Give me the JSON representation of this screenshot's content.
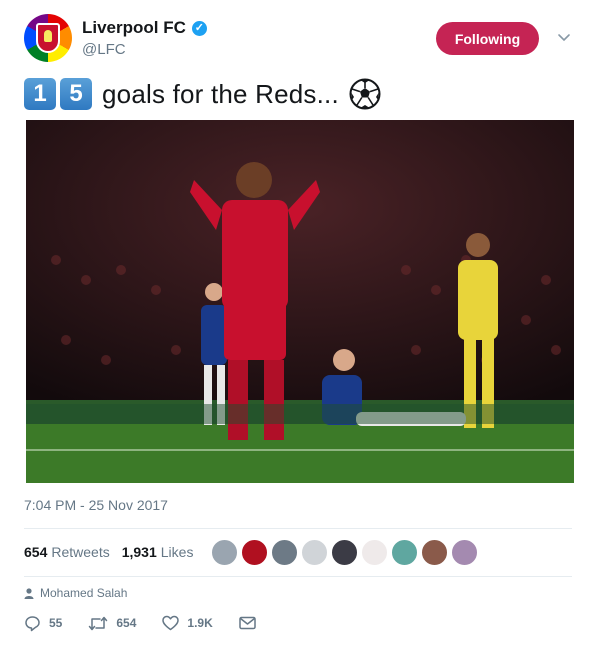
{
  "account": {
    "display_name": "Liverpool FC",
    "handle": "@LFC",
    "follow_label": "Following"
  },
  "tweet": {
    "keycaps": [
      "1",
      "5"
    ],
    "text": "goals for the Reds...",
    "timestamp": "7:04 PM - 25 Nov 2017"
  },
  "stats": {
    "retweets_count": "654",
    "retweets_label": "Retweets",
    "likes_count": "1,931",
    "likes_label": "Likes"
  },
  "context": {
    "tagged_person": "Mohamed Salah"
  },
  "actions": {
    "reply_count": "55",
    "retweet_count": "654",
    "like_count": "1.9K"
  },
  "colors": {
    "follow_button": "#c52454",
    "verified": "#1da1f2",
    "secondary_text": "#657786"
  }
}
